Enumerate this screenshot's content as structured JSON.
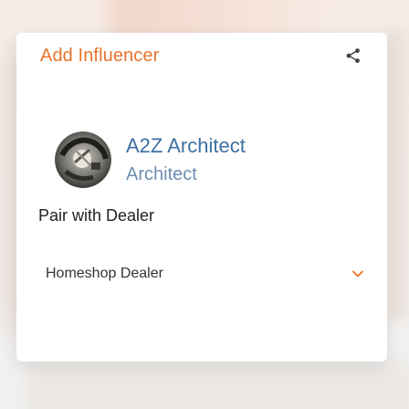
{
  "modal": {
    "title": "Add Influencer"
  },
  "influencer": {
    "name": "A2Z Architect",
    "role": "Architect"
  },
  "pairing": {
    "section_title": "Pair with Dealer",
    "selected_dealer": "Homeshop Dealer"
  },
  "colors": {
    "accent": "#e8732b",
    "name": "#3d6fa3",
    "role": "#6d8fb2"
  },
  "icons": {
    "share": "share-icon",
    "dropdown": "chevron-down-icon",
    "avatar": "avatar"
  }
}
